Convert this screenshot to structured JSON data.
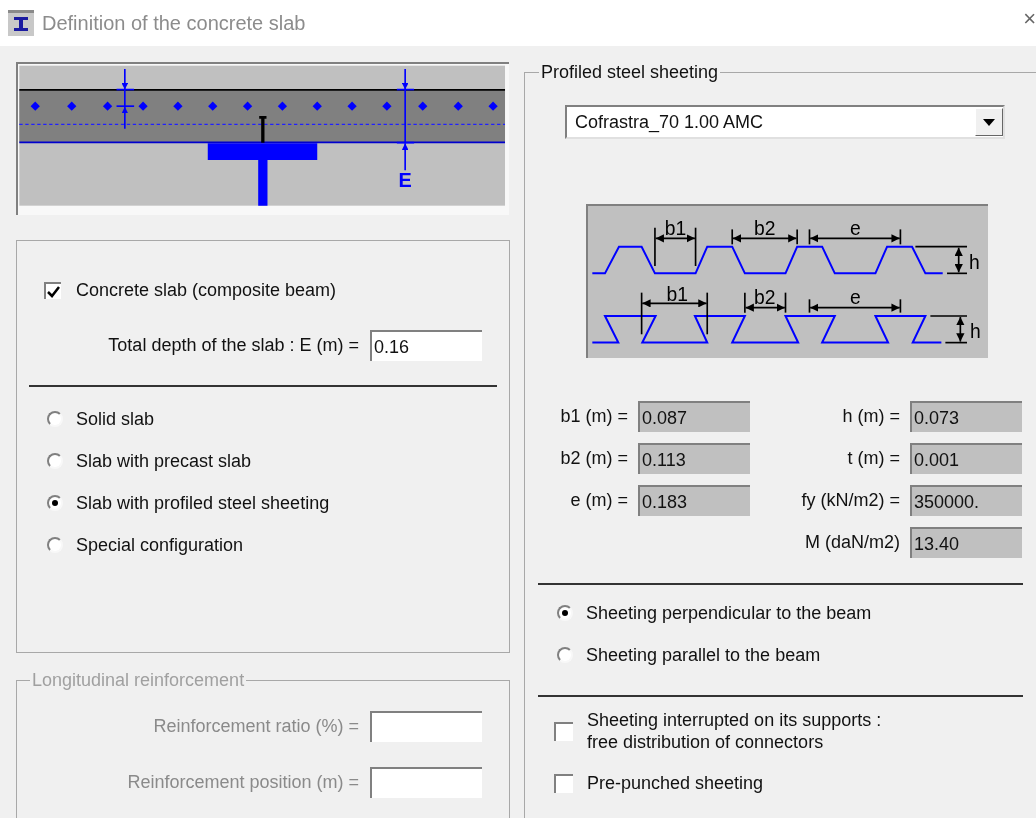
{
  "window": {
    "title": "Definition of the concrete slab",
    "close": "×"
  },
  "slab_diagram": {
    "dimension_label": "E"
  },
  "concrete_slab": {
    "label": "Concrete slab (composite beam)",
    "checked": true
  },
  "total_depth": {
    "label": "Total depth of the slab : E (m) =",
    "value": "0.16"
  },
  "slab_types": [
    {
      "label": "Solid slab",
      "selected": false
    },
    {
      "label": "Slab with precast slab",
      "selected": false
    },
    {
      "label": "Slab with profiled steel sheeting",
      "selected": true
    },
    {
      "label": "Special configuration",
      "selected": false
    }
  ],
  "longitudinal_reinforcement": {
    "title": "Longitudinal reinforcement",
    "disabled": true,
    "fields": [
      {
        "label": "Reinforcement ratio (%) ="
      },
      {
        "label": "Reinforcement position (m) ="
      }
    ]
  },
  "profiled_steel_sheeting": {
    "title": "Profiled steel sheeting",
    "profile": "Cofrastra_70 1.00 AMC",
    "diagram_rows": [
      {
        "labels": [
          "b1",
          "b2",
          "e",
          "h"
        ]
      },
      {
        "labels": [
          "b1",
          "b2",
          "e",
          "h"
        ]
      }
    ],
    "properties_left": [
      {
        "label": "b1 (m) =",
        "value": "0.087"
      },
      {
        "label": "b2 (m) =",
        "value": "0.113"
      },
      {
        "label": "e (m) =",
        "value": "0.183"
      }
    ],
    "properties_right": [
      {
        "label": "h (m) =",
        "value": "0.073"
      },
      {
        "label": "t (m) =",
        "value": "0.001"
      },
      {
        "label": "fy (kN/m2) =",
        "value": "350000."
      },
      {
        "label": "M (daN/m2)",
        "value": "13.40"
      }
    ],
    "orientation": [
      {
        "label": "Sheeting perpendicular to the beam",
        "selected": true
      },
      {
        "label": "Sheeting parallel to the beam",
        "selected": false
      }
    ],
    "options": [
      {
        "label": "Sheeting interrupted on its supports :\nfree distribution of connectors",
        "checked": false
      },
      {
        "label": "Pre-punched sheeting",
        "checked": false
      }
    ]
  }
}
